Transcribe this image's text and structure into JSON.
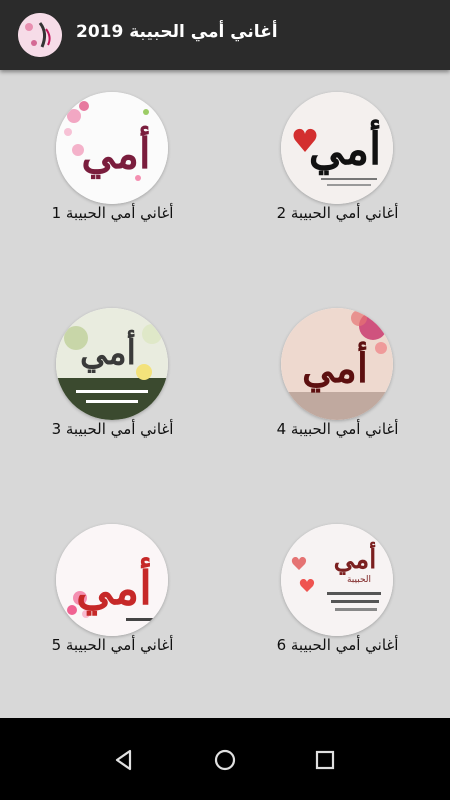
{
  "appbar": {
    "title": "أغاني أمي الحبيبة 2019",
    "icon": "app-logo-icon"
  },
  "items": [
    {
      "label": "أغاني أمي الحبيبة 1"
    },
    {
      "label": "أغاني أمي الحبيبة 2"
    },
    {
      "label": "أغاني أمي الحبيبة 3"
    },
    {
      "label": "أغاني أمي الحبيبة 4"
    },
    {
      "label": "أغاني أمي الحبيبة 5"
    },
    {
      "label": "أغاني أمي الحبيبة 6"
    }
  ],
  "thumbnail_text": {
    "t1": "أمي",
    "t2": "أمي",
    "t3": "أمي",
    "t4": "أمي",
    "t5": "أمي",
    "t6": "أمي",
    "t6_sub": "الحبيبة"
  },
  "navbar": {
    "back": "back-icon",
    "home": "home-icon",
    "recents": "recents-icon"
  },
  "colors": {
    "appbar": "#2b2b2b",
    "background": "#d8d8d8",
    "navbar": "#000000"
  }
}
